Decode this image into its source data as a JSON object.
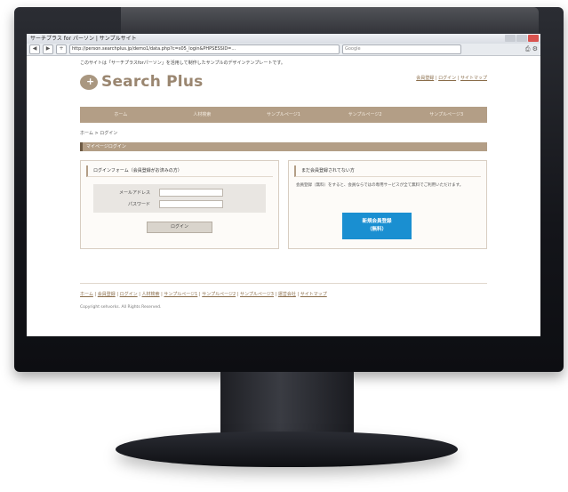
{
  "browser": {
    "window_title": "サーチプラス for パーソン | サンプルサイト",
    "url": "http://person.searchplus.jp/demo1/data.php?c=s05_login&PHPSESSID=...",
    "search_placeholder": "Google",
    "nav_back": "◀",
    "nav_forward": "▶",
    "nav_add": "+"
  },
  "site": {
    "intro": "このサイトは「サーチプラスforパーソン」を活用して制作したサンプルのデザインテンプレートです。",
    "logo_text": "Search Plus",
    "top_links": [
      "会員登録",
      "ログイン",
      "サイトマップ"
    ],
    "nav": [
      "ホーム",
      "人材検索",
      "サンプルページ1",
      "サンプルページ2",
      "サンプルページ3"
    ],
    "breadcrumb": "ホーム > ログイン",
    "section_title": "マイページログイン"
  },
  "login_panel": {
    "heading": "ログインフォーム（会員登録がお済みの方）",
    "email_label": "メールアドレス",
    "password_label": "パスワード",
    "login_button": "ログイン"
  },
  "register_panel": {
    "heading": "まだ会員登録されてない方",
    "description": "会員登録（無料）をすると、会員ならではの専用サービスが全て無料でご利用いただけます。",
    "button_line1": "新規会員登録",
    "button_line2": "（無料）"
  },
  "footer": {
    "links": [
      "ホーム",
      "会員登録",
      "ログイン",
      "人材検索",
      "サンプルページ1",
      "サンプルページ2",
      "サンプルページ3",
      "運営会社",
      "サイトマップ"
    ],
    "copyright": "Copyright sehvorks. All Rights Reserved."
  }
}
